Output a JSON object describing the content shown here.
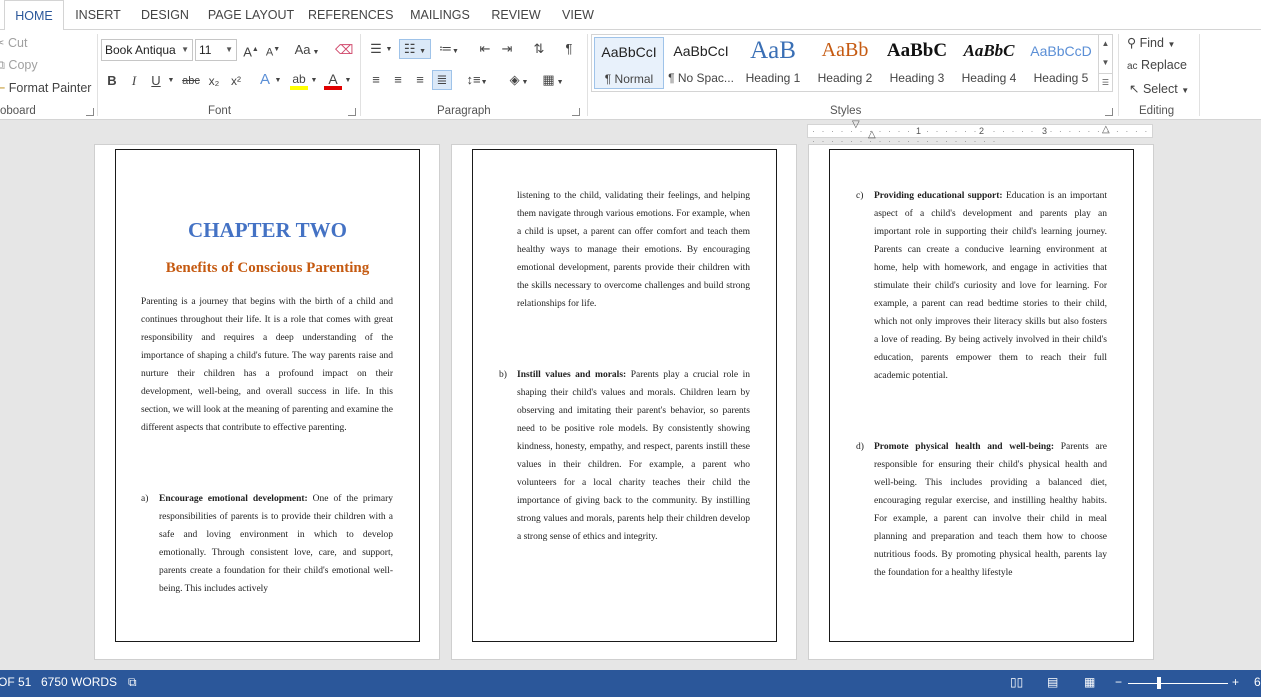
{
  "tabs": [
    "HOME",
    "INSERT",
    "DESIGN",
    "PAGE LAYOUT",
    "REFERENCES",
    "MAILINGS",
    "REVIEW",
    "VIEW"
  ],
  "clipboard": {
    "cut": "Cut",
    "copy": "Copy",
    "format_painter": "Format Painter",
    "group_label": "oboard"
  },
  "font": {
    "family": "Book Antiqua",
    "size": "11",
    "change_case": "Aa",
    "bold": "B",
    "italic": "I",
    "underline": "U",
    "strikethrough": "abc",
    "subscript": "x₂",
    "superscript": "x²",
    "group_label": "Font"
  },
  "paragraph": {
    "group_label": "Paragraph"
  },
  "styles": {
    "group_label": "Styles",
    "items": [
      {
        "sample": "AaBbCcI",
        "name": "¶ Normal"
      },
      {
        "sample": "AaBbCcI",
        "name": "¶ No Spac..."
      },
      {
        "sample": "AaB",
        "name": "Heading 1"
      },
      {
        "sample": "AaBb",
        "name": "Heading 2"
      },
      {
        "sample": "AaBbC",
        "name": "Heading 3"
      },
      {
        "sample": "AaBbC",
        "name": "Heading 4"
      },
      {
        "sample": "AaBbCcD",
        "name": "Heading 5"
      }
    ]
  },
  "editing": {
    "group_label": "Editing",
    "find": "Find",
    "replace": "Replace",
    "select": "Select"
  },
  "ruler_marks": [
    "1",
    "2",
    "3"
  ],
  "pages": {
    "p1": {
      "chapter_title": "CHAPTER TWO",
      "chapter_subtitle": "Benefits of Conscious Parenting",
      "intro": "Parenting is a journey that begins with the birth of a child and continues throughout their life. It is a role that comes with great responsibility and requires a deep understanding of the importance of shaping a child's future. The way parents raise and nurture their children has a profound impact on their development, well-being, and overall success in life. In this section, we will look at the meaning of parenting and examine the different aspects that contribute to effective parenting.",
      "item_a_marker": "a)",
      "item_a_head": "Encourage emotional development:",
      "item_a_text": " One of the primary responsibilities of parents is to provide their children with a safe and loving environment in which to develop emotionally. Through consistent love, care, and support, parents create a foundation for their child's emotional well-being. This includes actively"
    },
    "p2": {
      "continuation": "listening to the child, validating their feelings, and helping them navigate through various emotions. For example, when a child is upset, a parent can offer comfort and teach them healthy ways to manage their emotions. By encouraging emotional development, parents provide their children with the skills necessary to overcome challenges and build strong relationships for life.",
      "item_b_marker": "b)",
      "item_b_head": "Instill values and morals:",
      "item_b_text": " Parents play a crucial role in shaping their child's values and morals. Children learn by observing and imitating their parent's behavior, so parents need to be positive role models. By consistently showing kindness, honesty, empathy, and respect, parents instill these values in their children. For example, a parent who volunteers for a local charity teaches their child the importance of giving back to the community. By instilling strong values and morals, parents help their children develop a strong sense of ethics and integrity."
    },
    "p3": {
      "item_c_marker": "c)",
      "item_c_head": "Providing educational support:",
      "item_c_text": " Education is an important aspect of a child's development and parents play an important role in supporting their child's learning journey. Parents can create a conducive learning environment at home, help with homework, and engage in activities that stimulate their child's curiosity and love for learning. For example, a parent can read bedtime stories to their child, which not only improves their literacy skills but also fosters a love of reading. By being actively involved in their child's education, parents empower them to reach their full academic potential.",
      "item_d_marker": "d)",
      "item_d_head": "Promote physical health and well-being:",
      "item_d_text": " Parents are responsible for ensuring their child's physical health and well-being. This includes providing a balanced diet, encouraging regular exercise, and instilling healthy habits. For example, a parent can involve their child in meal planning and preparation and teach them how to choose nutritious foods. By promoting physical health, parents lay the foundation for a healthy lifestyle"
    }
  },
  "status": {
    "page": "OF 51",
    "words": "6750 WORDS",
    "zoom_minus": "−",
    "zoom_plus": "+",
    "zoom_partial": "6"
  },
  "colors": {
    "accent": "#2b579a",
    "chapter_title": "#4472c4",
    "chapter_subtitle": "#c55a11"
  }
}
